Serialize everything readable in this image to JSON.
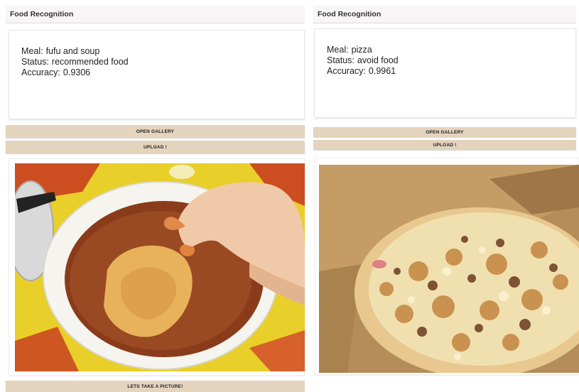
{
  "screens": [
    {
      "app_title": "Food Recognition",
      "result": {
        "meal_label": "Meal:",
        "meal_value": "fufu and soup",
        "status_label": "Status:",
        "status_value": "recommended food",
        "accuracy_label": "Accuracy:",
        "accuracy_value": "0.9306"
      },
      "open_gallery_label": "OPEN GALLERY",
      "upload_label": "UPLOAD !",
      "take_picture_label": "LETS TAKE A PICTURE!",
      "photo_subject": "fufu and soup photo"
    },
    {
      "app_title": "Food Recognition",
      "result": {
        "meal_label": "Meal:",
        "meal_value": "pizza",
        "status_label": "Status:",
        "status_value": "avoid food",
        "accuracy_label": "Accuracy:",
        "accuracy_value": "0.9961"
      },
      "open_gallery_label": "OPEN GALLERY",
      "upload_label": "UPLOAD !",
      "photo_subject": "pizza photo"
    }
  ],
  "colors": {
    "button_bg": "#e4d3bd",
    "appbar_bg": "#f7f5f5"
  }
}
